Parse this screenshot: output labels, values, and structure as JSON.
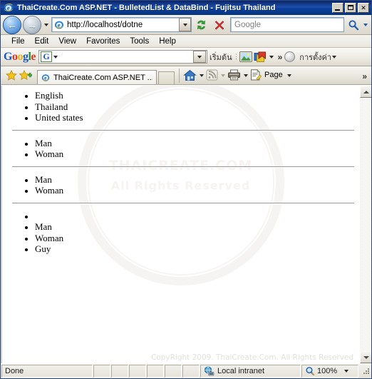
{
  "window": {
    "title": "ThaiCreate.Com ASP.NET - BulletedList & DataBind - Fujitsu Thailand",
    "minimize_label": "Minimize",
    "maximize_label": "Maximize",
    "close_label": "Close"
  },
  "nav": {
    "back_label": "Back",
    "forward_label": "Forward",
    "history_label": "Recent Pages",
    "address_value": "http://localhost/dotne",
    "address_dropdown_label": "Address history",
    "refresh_label": "Refresh",
    "stop_label": "Stop",
    "search_placeholder": "Google",
    "search_go_label": "Search",
    "search_provider_label": "Change search provider"
  },
  "menu": {
    "items": [
      {
        "label": "File"
      },
      {
        "label": "Edit"
      },
      {
        "label": "View"
      },
      {
        "label": "Favorites"
      },
      {
        "label": "Tools"
      },
      {
        "label": "Help"
      }
    ]
  },
  "google_toolbar": {
    "logo": {
      "g1": "G",
      "o1": "o",
      "o2": "o",
      "g2": "g",
      "l": "l",
      "e": "e"
    },
    "search_value": "",
    "mark_letter": "G",
    "start_label": "เริ่มต้น",
    "images_label": "Images",
    "bookmarks_label": "Bookmarks",
    "more_label": "»",
    "settings_label": "การตั้งค่า"
  },
  "tab_bar": {
    "favorites_label": "Favorites Center",
    "add_favorite_label": "Add to Favorites",
    "tab_title": "ThaiCreate.Com ASP.NET ...",
    "new_tab_label": "New Tab",
    "home_label": "Home",
    "feeds_label": "Feeds",
    "print_label": "Print",
    "page_label": "Page",
    "overflow_label": "»"
  },
  "page": {
    "blocks": [
      {
        "name": "countries-list",
        "items": [
          "English",
          "Thailand",
          "United states"
        ]
      },
      {
        "name": "gender-list-1",
        "items": [
          "Man",
          "Woman"
        ]
      },
      {
        "name": "gender-list-2",
        "items": [
          "Man",
          "Woman"
        ]
      },
      {
        "name": "gender-list-3",
        "items": [
          "",
          "Man",
          "Woman",
          "Guy"
        ]
      }
    ],
    "watermark_line1": "THAICREATE.COM",
    "watermark_line2": "All Rights Reserved",
    "copyright": "CopyRight 2009. ThaiCreate.Com. All Rights Reserved"
  },
  "scrollbar": {
    "up_label": "Scroll up",
    "down_label": "Scroll down"
  },
  "status_bar": {
    "status": "Done",
    "zone": "Local intranet",
    "zoom": "100%",
    "zoom_dropdown_label": "Change zoom level",
    "resize_grip_label": "Resize"
  },
  "colors": {
    "title_bar": "#0a246a",
    "chrome": "#d4d0c8",
    "page_bg": "#ffffff",
    "accent_blue": "#1a57c7"
  }
}
